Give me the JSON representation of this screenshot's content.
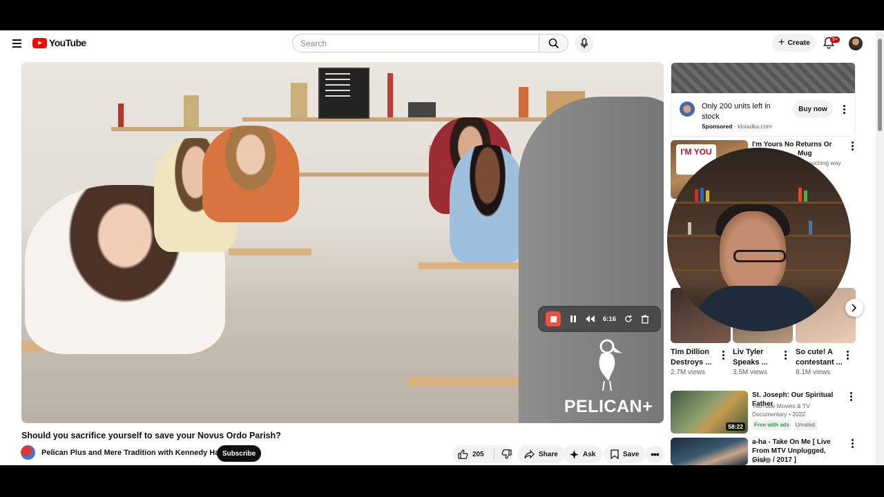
{
  "header": {
    "logo_text": "YouTube",
    "search_placeholder": "Search",
    "create_label": "Create",
    "notification_count": "9+"
  },
  "player": {
    "recorder": {
      "elapsed": "6:16"
    },
    "watermark": "PELICAN+"
  },
  "video": {
    "title": "Should you sacrifice yourself to save your Novus Ordo Parish?",
    "channel": "Pelican Plus and Mere Tradition with Kennedy Hall",
    "subscribe_label": "Subscribe",
    "likes": "205",
    "share_label": "Share",
    "ask_label": "Ask",
    "save_label": "Save"
  },
  "sidebar": {
    "ad": {
      "text": "Only 200 units left in stock",
      "sponsored": "Sponsored",
      "domain": "kloiadka.com",
      "button": "Buy now"
    },
    "first_item": {
      "title": "I'm Yours No Returns Or",
      "title2": "Mug",
      "meta": "touching way",
      "mug_text": "I'M YOU"
    },
    "shorts": [
      {
        "title": "Tim Dillion Destroys ...",
        "views": "2.7M views"
      },
      {
        "title": "Liv Tyler Speaks ...",
        "views": "3.5M views"
      },
      {
        "title": "So cute! A contestant ...",
        "views": "8.1M views"
      }
    ],
    "videos": [
      {
        "title": "St. Joseph: Our Spiritual Father",
        "channel": "YouTube Movies & TV",
        "meta": "Documentary • 2022",
        "tag1": "Free with ads",
        "tag2": "Unrated",
        "duration": "58:22"
      },
      {
        "title": "a-ha - Take On Me [ Live From MTV Unplugged, Giske / 2017 ]",
        "channel": "a-ha"
      }
    ]
  },
  "colors": {
    "brand_red": "#ff0000",
    "recorder_stop": "#f0523b",
    "free_with_ads": "#2ba640"
  }
}
